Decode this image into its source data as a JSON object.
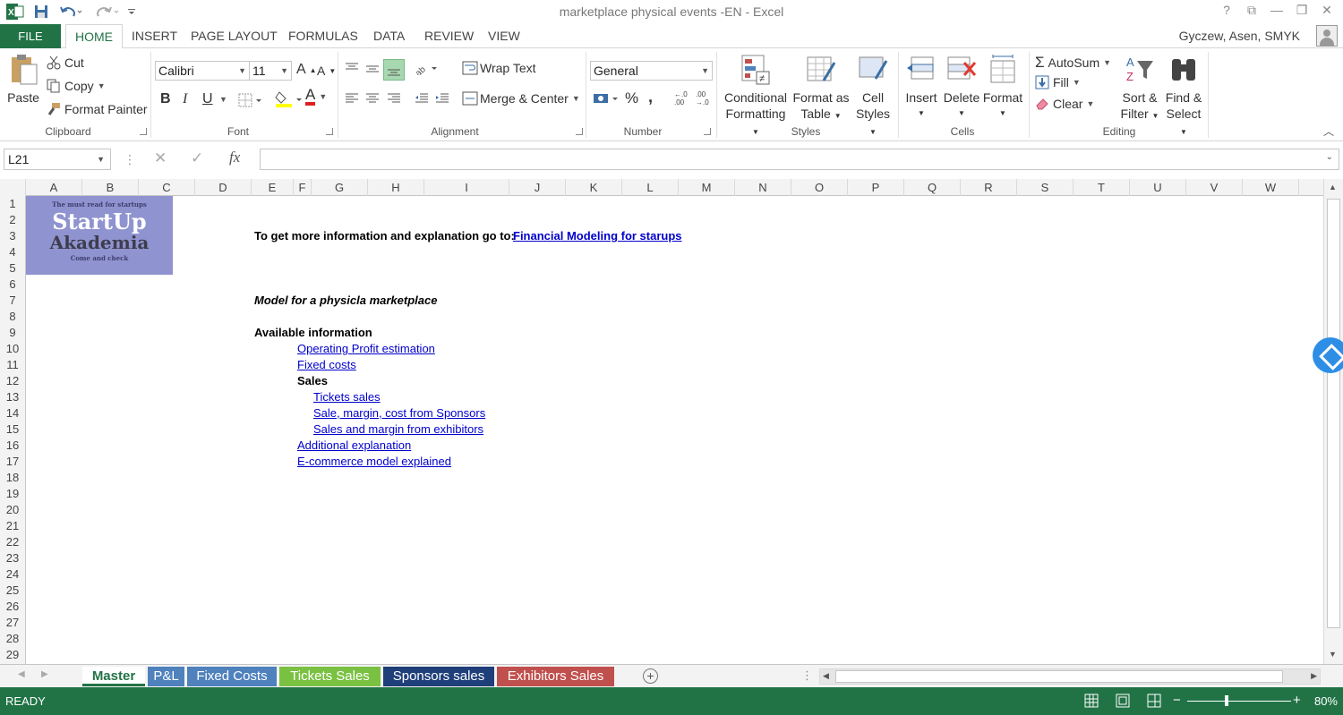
{
  "window": {
    "title": "marketplace physical events -EN - Excel",
    "controls": [
      "?",
      "⧉",
      "—",
      "❐",
      "✕"
    ]
  },
  "ribbon_tabs": {
    "file": "FILE",
    "tabs": [
      "HOME",
      "INSERT",
      "PAGE LAYOUT",
      "FORMULAS",
      "DATA",
      "REVIEW",
      "VIEW"
    ],
    "active": "HOME",
    "user": "Gyczew, Asen, SMYK"
  },
  "clipboard": {
    "paste": "Paste",
    "cut": "Cut",
    "copy": "Copy",
    "format_painter": "Format Painter",
    "label": "Clipboard"
  },
  "font": {
    "name": "Calibri",
    "size": "11",
    "bold": "B",
    "italic": "I",
    "underline": "U",
    "font_color": "A",
    "label": "Font"
  },
  "alignment": {
    "wrap": "Wrap Text",
    "merge": "Merge & Center",
    "label": "Alignment"
  },
  "number": {
    "format": "General",
    "percent": "%",
    "comma": ",",
    "label": "Number"
  },
  "styles": {
    "conditional_1": "Conditional",
    "conditional_2": "Formatting",
    "format_table_1": "Format as",
    "format_table_2": "Table",
    "cell_styles_1": "Cell",
    "cell_styles_2": "Styles",
    "label": "Styles"
  },
  "cells": {
    "insert": "Insert",
    "delete": "Delete",
    "format": "Format",
    "label": "Cells"
  },
  "editing": {
    "autosum": "AutoSum",
    "fill": "Fill",
    "clear": "Clear",
    "sort_1": "Sort &",
    "sort_2": "Filter",
    "find_1": "Find &",
    "find_2": "Select",
    "label": "Editing"
  },
  "formula_bar": {
    "name_box": "L21",
    "fx": "fx",
    "value": ""
  },
  "columns": [
    "A",
    "B",
    "C",
    "D",
    "E",
    "F",
    "G",
    "H",
    "I",
    "J",
    "K",
    "L",
    "M",
    "N",
    "O",
    "P",
    "Q",
    "R",
    "S",
    "T",
    "U",
    "V",
    "W"
  ],
  "rows": [
    "1",
    "2",
    "3",
    "4",
    "5",
    "6",
    "7",
    "8",
    "9",
    "10",
    "11",
    "12",
    "13",
    "14",
    "15",
    "16",
    "17",
    "18",
    "19",
    "20",
    "21",
    "22",
    "23",
    "24",
    "25",
    "26",
    "27",
    "28",
    "29"
  ],
  "logo": {
    "tagline": "The must read for startups",
    "line1": "StartUp",
    "line2": "Akademia",
    "footer": "Come and check"
  },
  "sheet": {
    "info_prefix": "To get more information and explanation go to:",
    "info_link": "Financial Modeling for starups",
    "model_title": "Model for a physicla marketplace",
    "available": "Available information",
    "links": {
      "operating": "Operating Profit estimation",
      "fixed": "Fixed costs",
      "sales": "Sales",
      "tickets": "Tickets sales",
      "sponsors": "Sale, margin, cost from Sponsors",
      "exhibitors": "Sales and margin from exhibitors",
      "additional": "Additional explanation",
      "ecommerce": "E-commerce model explained"
    }
  },
  "sheet_tabs": [
    {
      "label": "Master",
      "color": "#ffffff"
    },
    {
      "label": "P&L",
      "color": "#4f81bd"
    },
    {
      "label": "Fixed Costs",
      "color": "#4f81bd"
    },
    {
      "label": "Tickets Sales",
      "color": "#7ac142"
    },
    {
      "label": "Sponsors sales",
      "color": "#1f3f7a"
    },
    {
      "label": "Exhibitors Sales",
      "color": "#c0504d"
    }
  ],
  "status": {
    "text": "READY",
    "zoom": "80%"
  }
}
